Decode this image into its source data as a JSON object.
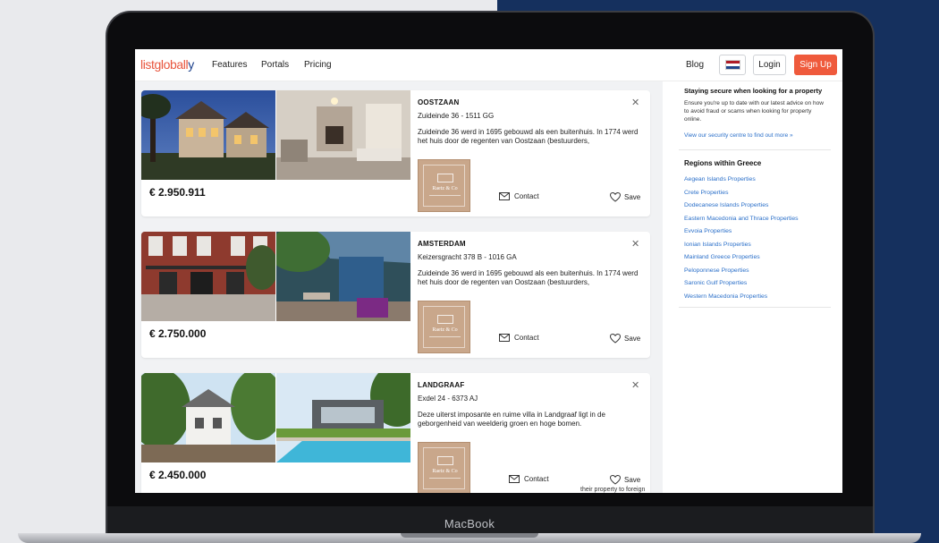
{
  "device": {
    "label": "MacBook"
  },
  "nav": {
    "logo_main": "listgloball",
    "logo_tail": "y",
    "links": [
      "Features",
      "Portals",
      "Pricing"
    ],
    "blog": "Blog",
    "language_flag": "netherlands-flag",
    "login": "Login",
    "signup": "Sign Up"
  },
  "listings": [
    {
      "title": "OOSTZAAN",
      "address": "Zuideinde 36 - 1511 GG",
      "description": "Zuideinde 36 werd in 1695 gebouwd als een buitenhuis. In 1774 werd het huis door de regenten van Oostzaan (bestuurders,",
      "price": "€ 2.950.911",
      "contact": "Contact",
      "save": "Save"
    },
    {
      "title": "AMSTERDAM",
      "address": "Keizersgracht 378 B - 1016 GA",
      "description": "Zuideinde 36 werd in 1695 gebouwd als een buitenhuis. In 1774 werd het huis door de regenten van Oostzaan (bestuurders,",
      "price": "€ 2.750.000",
      "contact": "Contact",
      "save": "Save"
    },
    {
      "title": "LANDGRAAF",
      "address": "Exdel 24 - 6373 AJ",
      "description": "Deze uiterst imposante en ruime villa in Landgraaf ligt in de geborgenheid van weelderig groen en hoge bomen.",
      "price": "€ 2.450.000",
      "contact": "Contact",
      "save": "Save"
    }
  ],
  "agency": {
    "name": "Raetz & Co"
  },
  "overflow_text": "their property to foreign",
  "sidebar": {
    "security_title": "Staying secure when looking for a property",
    "security_text": "Ensure you're up to date with our latest advice on how to avoid fraud or scams when looking for property online.",
    "security_link": "View our security centre to find out more »",
    "regions_title": "Regions within Greece",
    "regions": [
      "Aegean Islands Properties",
      "Crete Properties",
      "Dodecanese Islands Properties",
      "Eastern Macedonia and Thrace Properties",
      "Evvoia Properties",
      "Ionian Islands Properties",
      "Mainland Greece Properties",
      "Peloponnese Properties",
      "Saronic Gulf Properties",
      "Western Macedonia Properties"
    ]
  },
  "colors": {
    "brand_orange": "#ef5a3c",
    "brand_navy": "#15305e",
    "link_blue": "#2a6fc9",
    "agency_tan": "#c9a78b"
  }
}
